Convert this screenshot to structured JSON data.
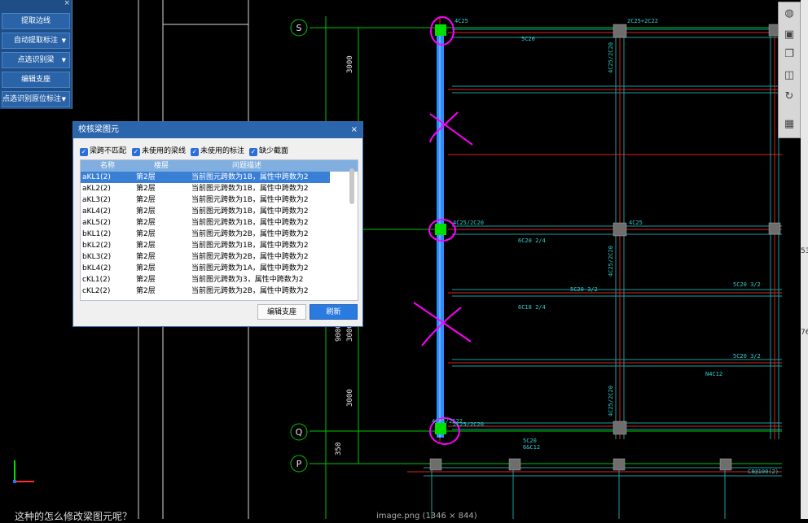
{
  "tool_panel": {
    "close": "×",
    "buttons": [
      {
        "label": "提取边线",
        "dropdown": false
      },
      {
        "label": "自动提取标注",
        "dropdown": true
      },
      {
        "label": "点选识别梁",
        "dropdown": true
      },
      {
        "label": "编辑支座",
        "dropdown": false
      },
      {
        "label": "点选识别原位标注",
        "dropdown": true
      }
    ]
  },
  "dialog": {
    "title": "校核梁图元",
    "close": "×",
    "filters": [
      {
        "label": "梁跨不匹配",
        "checked": true
      },
      {
        "label": "未使用的梁线",
        "checked": true
      },
      {
        "label": "未使用的标注",
        "checked": true
      },
      {
        "label": "缺少截面",
        "checked": true
      }
    ],
    "columns": [
      "名称",
      "楼层",
      "问题描述"
    ],
    "rows": [
      {
        "name": "aKL1(2)",
        "floor": "第2层",
        "desc": "当前图元跨数为1B，属性中跨数为2",
        "selected": true
      },
      {
        "name": "aKL2(2)",
        "floor": "第2层",
        "desc": "当前图元跨数为1B，属性中跨数为2"
      },
      {
        "name": "aKL3(2)",
        "floor": "第2层",
        "desc": "当前图元跨数为1B，属性中跨数为2"
      },
      {
        "name": "aKL4(2)",
        "floor": "第2层",
        "desc": "当前图元跨数为1B，属性中跨数为2"
      },
      {
        "name": "aKL5(2)",
        "floor": "第2层",
        "desc": "当前图元跨数为1B，属性中跨数为2"
      },
      {
        "name": "bKL1(2)",
        "floor": "第2层",
        "desc": "当前图元跨数为2B，属性中跨数为2"
      },
      {
        "name": "bKL2(2)",
        "floor": "第2层",
        "desc": "当前图元跨数为1B，属性中跨数为2"
      },
      {
        "name": "bKL3(2)",
        "floor": "第2层",
        "desc": "当前图元跨数为2B，属性中跨数为2"
      },
      {
        "name": "bKL4(2)",
        "floor": "第2层",
        "desc": "当前图元跨数为1A，属性中跨数为2"
      },
      {
        "name": "cKL1(2)",
        "floor": "第2层",
        "desc": "当前图元跨数为3，属性中跨数为2"
      },
      {
        "name": "cKL2(2)",
        "floor": "第2层",
        "desc": "当前图元跨数为2B，属性中跨数为2"
      }
    ],
    "edit_button": "编辑支座",
    "refresh_button": "刷新"
  },
  "drawing": {
    "axis_labels": [
      "S",
      "Q",
      "P"
    ],
    "dimensions": [
      "3000",
      "9000",
      "3000",
      "3000",
      "350"
    ],
    "beam_labels": [
      "4C25",
      "2C25+2C22",
      "5C20",
      "4C25/2C20",
      "6C20 2/4",
      "5C20 3/2",
      "6C18 2/4",
      "4C25/2C22",
      "5C20",
      "6&C12",
      "C8@100(2)",
      "N4C12",
      "4C25",
      "2C25/2C20"
    ]
  },
  "right_strip": {
    "values": [
      "53",
      "76"
    ]
  },
  "bottom": {
    "question": "这种的怎么修改梁图元呢？",
    "image_caption": "image.png (1346 × 844)"
  },
  "colors": {
    "grid": "#00c800",
    "beam": "#ff3030",
    "selected_beam": "#2d8cff",
    "column": "#6e6e6e",
    "annotation": "#ff00ff",
    "dialog_title": "#2b66ad"
  }
}
